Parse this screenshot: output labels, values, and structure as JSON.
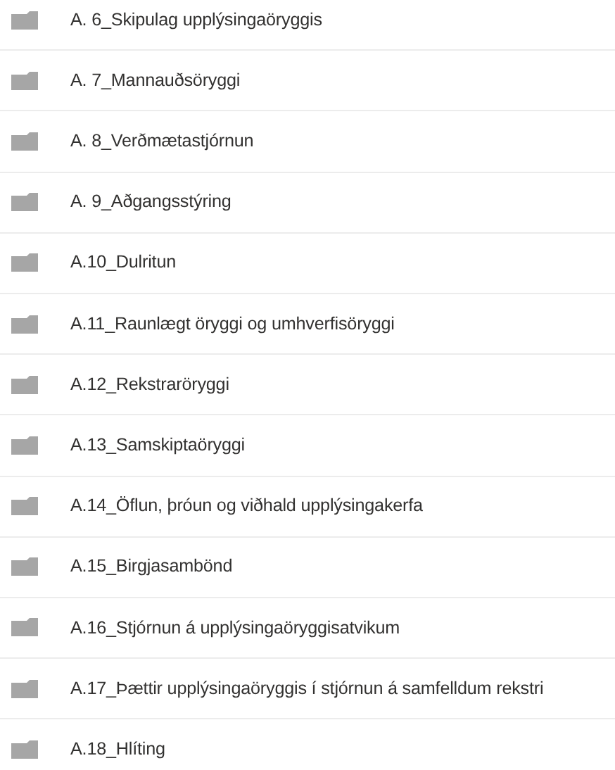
{
  "folders": [
    {
      "name": "A. 6_Skipulag upplýsingaöryggis"
    },
    {
      "name": "A. 7_Mannauðsöryggi"
    },
    {
      "name": "A. 8_Verðmætastjórnun"
    },
    {
      "name": "A. 9_Aðgangsstýring"
    },
    {
      "name": "A.10_Dulritun"
    },
    {
      "name": "A.11_Raunlægt öryggi og umhverfisöryggi"
    },
    {
      "name": "A.12_Rekstraröryggi"
    },
    {
      "name": "A.13_Samskiptaöryggi"
    },
    {
      "name": "A.14_Öflun, þróun og viðhald upplýsingakerfa"
    },
    {
      "name": "A.15_Birgjasambönd"
    },
    {
      "name": "A.16_Stjórnun á upplýsingaöryggisatvikum"
    },
    {
      "name": "A.17_Þættir upplýsingaöryggis í stjórnun á samfelldum rekstri"
    },
    {
      "name": "A.18_Hlíting"
    }
  ]
}
